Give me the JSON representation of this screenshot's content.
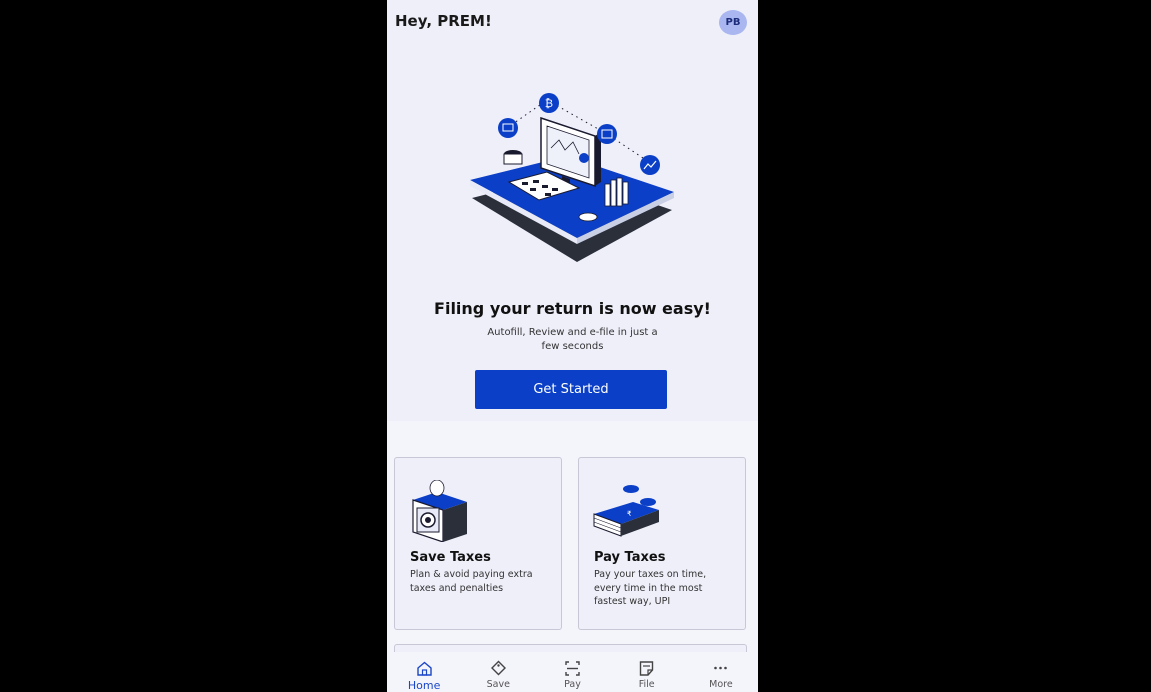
{
  "header": {
    "greeting": "Hey, PREM!",
    "avatar_initials": "PB"
  },
  "hero": {
    "title": "Filing your return is now easy!",
    "subtitle": "Autofill, Review and e-file in just a few seconds",
    "cta_label": "Get Started"
  },
  "cards": [
    {
      "title": "Save Taxes",
      "description": "Plan & avoid paying extra taxes and penalties",
      "icon": "safe-icon"
    },
    {
      "title": "Pay Taxes",
      "description": "Pay your taxes on time, every time in the most fastest way, UPI",
      "icon": "money-stack-icon"
    }
  ],
  "nav": [
    {
      "label": "Home",
      "icon": "home-icon",
      "active": true
    },
    {
      "label": "Save",
      "icon": "tag-icon",
      "active": false
    },
    {
      "label": "Pay",
      "icon": "scan-icon",
      "active": false
    },
    {
      "label": "File",
      "icon": "document-icon",
      "active": false
    },
    {
      "label": "More",
      "icon": "more-icon",
      "active": false
    }
  ],
  "colors": {
    "primary": "#0b3fc7",
    "background": "#efeffa",
    "avatar": "#a9b6ef"
  }
}
